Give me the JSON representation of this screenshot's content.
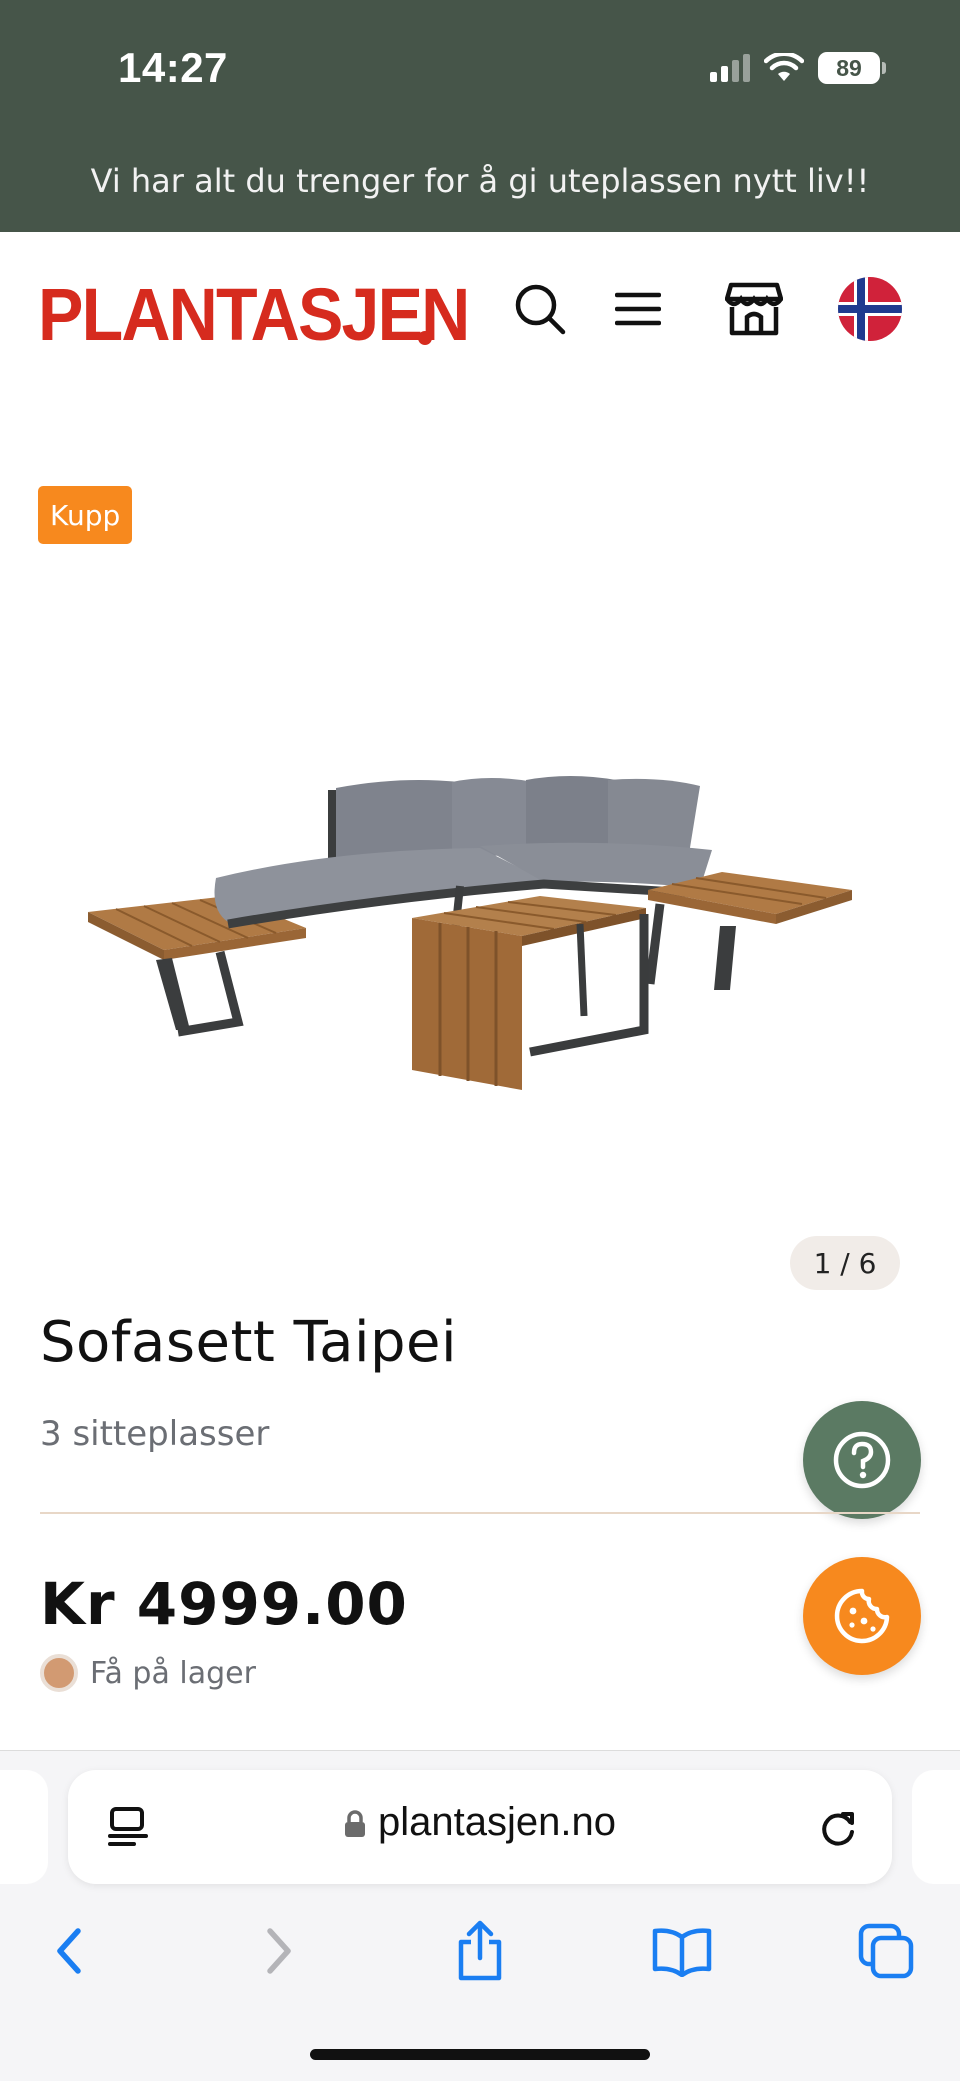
{
  "status_bar": {
    "time": "14:27",
    "battery": "89"
  },
  "banner": {
    "text": "Vi har alt du trenger for å gi uteplassen nytt liv!!"
  },
  "header": {
    "logo": "PLANTASJEN",
    "icons": [
      "search-icon",
      "menu-icon",
      "store-icon",
      "norway-flag-icon"
    ]
  },
  "product": {
    "badge": "Kupp",
    "image_pager": "1 / 6",
    "title": "Sofasett Taipei",
    "subtitle": "3 sitteplasser",
    "price": "Kr 4999.00",
    "stock_status": "Få på lager"
  },
  "floating": {
    "help_icon": "question-icon",
    "cookie_icon": "cookie-icon"
  },
  "browser": {
    "url": "plantasjen.no",
    "toolbar_icons": [
      "back-icon",
      "forward-icon",
      "share-icon",
      "bookmarks-icon",
      "tabs-icon"
    ]
  },
  "colors": {
    "top_bar": "#465549",
    "logo_red": "#d62b1e",
    "badge_orange": "#f7891e",
    "help_green": "#5b7a63",
    "ios_blue": "#1a7ef2"
  }
}
